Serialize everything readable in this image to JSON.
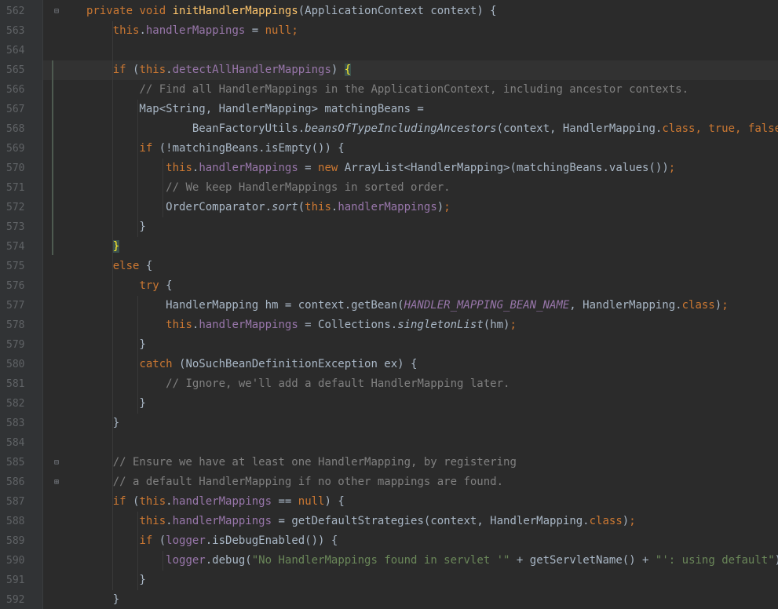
{
  "editor": {
    "line_numbers": [
      "562",
      "563",
      "564",
      "565",
      "566",
      "567",
      "568",
      "569",
      "570",
      "571",
      "572",
      "573",
      "574",
      "575",
      "576",
      "577",
      "578",
      "579",
      "580",
      "581",
      "582",
      "583",
      "584",
      "585",
      "586",
      "587",
      "588",
      "589",
      "590",
      "591",
      "592"
    ],
    "colors": {
      "background": "#2b2b2b",
      "gutter": "#313335",
      "keyword": "#cc7832",
      "method_decl": "#ffc66d",
      "field": "#9876aa",
      "comment": "#808080",
      "string": "#6a8759",
      "text": "#a9b7c6",
      "brace_match": "#ffef28"
    },
    "icons": [
      "fold-minus-icon",
      "fold-end-icon"
    ],
    "lines": [
      {
        "segments": [
          {
            "t": "private ",
            "c": "kw"
          },
          {
            "t": "void ",
            "c": "kw"
          },
          {
            "t": "initHandlerMappings",
            "c": "fn"
          },
          {
            "t": "(ApplicationContext context) {",
            "c": ""
          }
        ]
      },
      {
        "segments": [
          {
            "t": "    ",
            "c": ""
          },
          {
            "t": "this",
            "c": "kw"
          },
          {
            "t": ".",
            "c": ""
          },
          {
            "t": "handlerMappings",
            "c": "fld"
          },
          {
            "t": " = ",
            "c": ""
          },
          {
            "t": "null",
            "c": "kw"
          },
          {
            "t": ";",
            "c": "kw"
          }
        ]
      },
      {
        "segments": []
      },
      {
        "segments": [
          {
            "t": "    ",
            "c": ""
          },
          {
            "t": "if ",
            "c": "kw"
          },
          {
            "t": "(",
            "c": ""
          },
          {
            "t": "this",
            "c": "kw"
          },
          {
            "t": ".",
            "c": ""
          },
          {
            "t": "detectAllHandlerMappings",
            "c": "fld"
          },
          {
            "t": ") ",
            "c": ""
          },
          {
            "t": "{",
            "c": "brace-match"
          }
        ]
      },
      {
        "segments": [
          {
            "t": "        ",
            "c": ""
          },
          {
            "t": "// Find all HandlerMappings in the ApplicationContext, including ancestor contexts.",
            "c": "cm"
          }
        ]
      },
      {
        "segments": [
          {
            "t": "        Map<String, HandlerMapping> matchingBeans =",
            "c": ""
          }
        ]
      },
      {
        "segments": [
          {
            "t": "                BeanFactoryUtils.",
            "c": ""
          },
          {
            "t": "beansOfTypeIncludingAncestors",
            "c": "it"
          },
          {
            "t": "(context, HandlerMapping.",
            "c": ""
          },
          {
            "t": "class",
            "c": "kw"
          },
          {
            "t": ", ",
            "c": "kw"
          },
          {
            "t": "true",
            "c": "kw"
          },
          {
            "t": ", ",
            "c": "kw"
          },
          {
            "t": "false",
            "c": "kw"
          },
          {
            "t": ");",
            "c": ""
          }
        ]
      },
      {
        "segments": [
          {
            "t": "        ",
            "c": ""
          },
          {
            "t": "if ",
            "c": "kw"
          },
          {
            "t": "(!matchingBeans.isEmpty()) {",
            "c": ""
          }
        ]
      },
      {
        "segments": [
          {
            "t": "            ",
            "c": ""
          },
          {
            "t": "this",
            "c": "kw"
          },
          {
            "t": ".",
            "c": ""
          },
          {
            "t": "handlerMappings",
            "c": "fld"
          },
          {
            "t": " = ",
            "c": ""
          },
          {
            "t": "new ",
            "c": "kw"
          },
          {
            "t": "ArrayList<HandlerMapping>(matchingBeans.values())",
            "c": ""
          },
          {
            "t": ";",
            "c": "kw"
          }
        ]
      },
      {
        "segments": [
          {
            "t": "            ",
            "c": ""
          },
          {
            "t": "// We keep HandlerMappings in sorted order.",
            "c": "cm"
          }
        ]
      },
      {
        "segments": [
          {
            "t": "            OrderComparator.",
            "c": ""
          },
          {
            "t": "sort",
            "c": "it"
          },
          {
            "t": "(",
            "c": ""
          },
          {
            "t": "this",
            "c": "kw"
          },
          {
            "t": ".",
            "c": ""
          },
          {
            "t": "handlerMappings",
            "c": "fld"
          },
          {
            "t": ")",
            "c": ""
          },
          {
            "t": ";",
            "c": "kw"
          }
        ]
      },
      {
        "segments": [
          {
            "t": "        }",
            "c": ""
          }
        ]
      },
      {
        "segments": [
          {
            "t": "    ",
            "c": ""
          },
          {
            "t": "}",
            "c": "brace-match"
          }
        ]
      },
      {
        "segments": [
          {
            "t": "    ",
            "c": ""
          },
          {
            "t": "else ",
            "c": "kw"
          },
          {
            "t": "{",
            "c": ""
          }
        ]
      },
      {
        "segments": [
          {
            "t": "        ",
            "c": ""
          },
          {
            "t": "try ",
            "c": "kw"
          },
          {
            "t": "{",
            "c": ""
          }
        ]
      },
      {
        "segments": [
          {
            "t": "            HandlerMapping hm = context.getBean(",
            "c": ""
          },
          {
            "t": "HANDLER_MAPPING_BEAN_NAME",
            "c": "st"
          },
          {
            "t": ", HandlerMapping.",
            "c": ""
          },
          {
            "t": "class",
            "c": "kw"
          },
          {
            "t": ")",
            "c": ""
          },
          {
            "t": ";",
            "c": "kw"
          }
        ]
      },
      {
        "segments": [
          {
            "t": "            ",
            "c": ""
          },
          {
            "t": "this",
            "c": "kw"
          },
          {
            "t": ".",
            "c": ""
          },
          {
            "t": "handlerMappings",
            "c": "fld"
          },
          {
            "t": " = Collections.",
            "c": ""
          },
          {
            "t": "singletonList",
            "c": "it"
          },
          {
            "t": "(hm)",
            "c": ""
          },
          {
            "t": ";",
            "c": "kw"
          }
        ]
      },
      {
        "segments": [
          {
            "t": "        }",
            "c": ""
          }
        ]
      },
      {
        "segments": [
          {
            "t": "        ",
            "c": ""
          },
          {
            "t": "catch ",
            "c": "kw"
          },
          {
            "t": "(NoSuchBeanDefinitionException ex) {",
            "c": ""
          }
        ]
      },
      {
        "segments": [
          {
            "t": "            ",
            "c": ""
          },
          {
            "t": "// Ignore, we'll add a default HandlerMapping later.",
            "c": "cm"
          }
        ]
      },
      {
        "segments": [
          {
            "t": "        }",
            "c": ""
          }
        ]
      },
      {
        "segments": [
          {
            "t": "    }",
            "c": ""
          }
        ]
      },
      {
        "segments": []
      },
      {
        "segments": [
          {
            "t": "    ",
            "c": ""
          },
          {
            "t": "// Ensure we have at least one HandlerMapping, by registering",
            "c": "cm"
          }
        ]
      },
      {
        "segments": [
          {
            "t": "    ",
            "c": ""
          },
          {
            "t": "// a default HandlerMapping if no other mappings are found.",
            "c": "cm"
          }
        ]
      },
      {
        "segments": [
          {
            "t": "    ",
            "c": ""
          },
          {
            "t": "if ",
            "c": "kw"
          },
          {
            "t": "(",
            "c": ""
          },
          {
            "t": "this",
            "c": "kw"
          },
          {
            "t": ".",
            "c": ""
          },
          {
            "t": "handlerMappings",
            "c": "fld"
          },
          {
            "t": " == ",
            "c": ""
          },
          {
            "t": "null",
            "c": "kw"
          },
          {
            "t": ") {",
            "c": ""
          }
        ]
      },
      {
        "segments": [
          {
            "t": "        ",
            "c": ""
          },
          {
            "t": "this",
            "c": "kw"
          },
          {
            "t": ".",
            "c": ""
          },
          {
            "t": "handlerMappings",
            "c": "fld"
          },
          {
            "t": " = getDefaultStrategies(context, HandlerMapping.",
            "c": ""
          },
          {
            "t": "class",
            "c": "kw"
          },
          {
            "t": ")",
            "c": ""
          },
          {
            "t": ";",
            "c": "kw"
          }
        ]
      },
      {
        "segments": [
          {
            "t": "        ",
            "c": ""
          },
          {
            "t": "if ",
            "c": "kw"
          },
          {
            "t": "(",
            "c": ""
          },
          {
            "t": "logger",
            "c": "fld"
          },
          {
            "t": ".isDebugEnabled()) {",
            "c": ""
          }
        ]
      },
      {
        "segments": [
          {
            "t": "            ",
            "c": ""
          },
          {
            "t": "logger",
            "c": "fld"
          },
          {
            "t": ".debug(",
            "c": ""
          },
          {
            "t": "\"No HandlerMappings found in servlet '\"",
            "c": "str"
          },
          {
            "t": " + getServletName() + ",
            "c": ""
          },
          {
            "t": "\"': using default\"",
            "c": "str"
          },
          {
            "t": ")",
            "c": ""
          },
          {
            "t": ";",
            "c": "kw"
          }
        ]
      },
      {
        "segments": [
          {
            "t": "        }",
            "c": ""
          }
        ]
      },
      {
        "segments": [
          {
            "t": "    }",
            "c": ""
          }
        ]
      }
    ]
  }
}
